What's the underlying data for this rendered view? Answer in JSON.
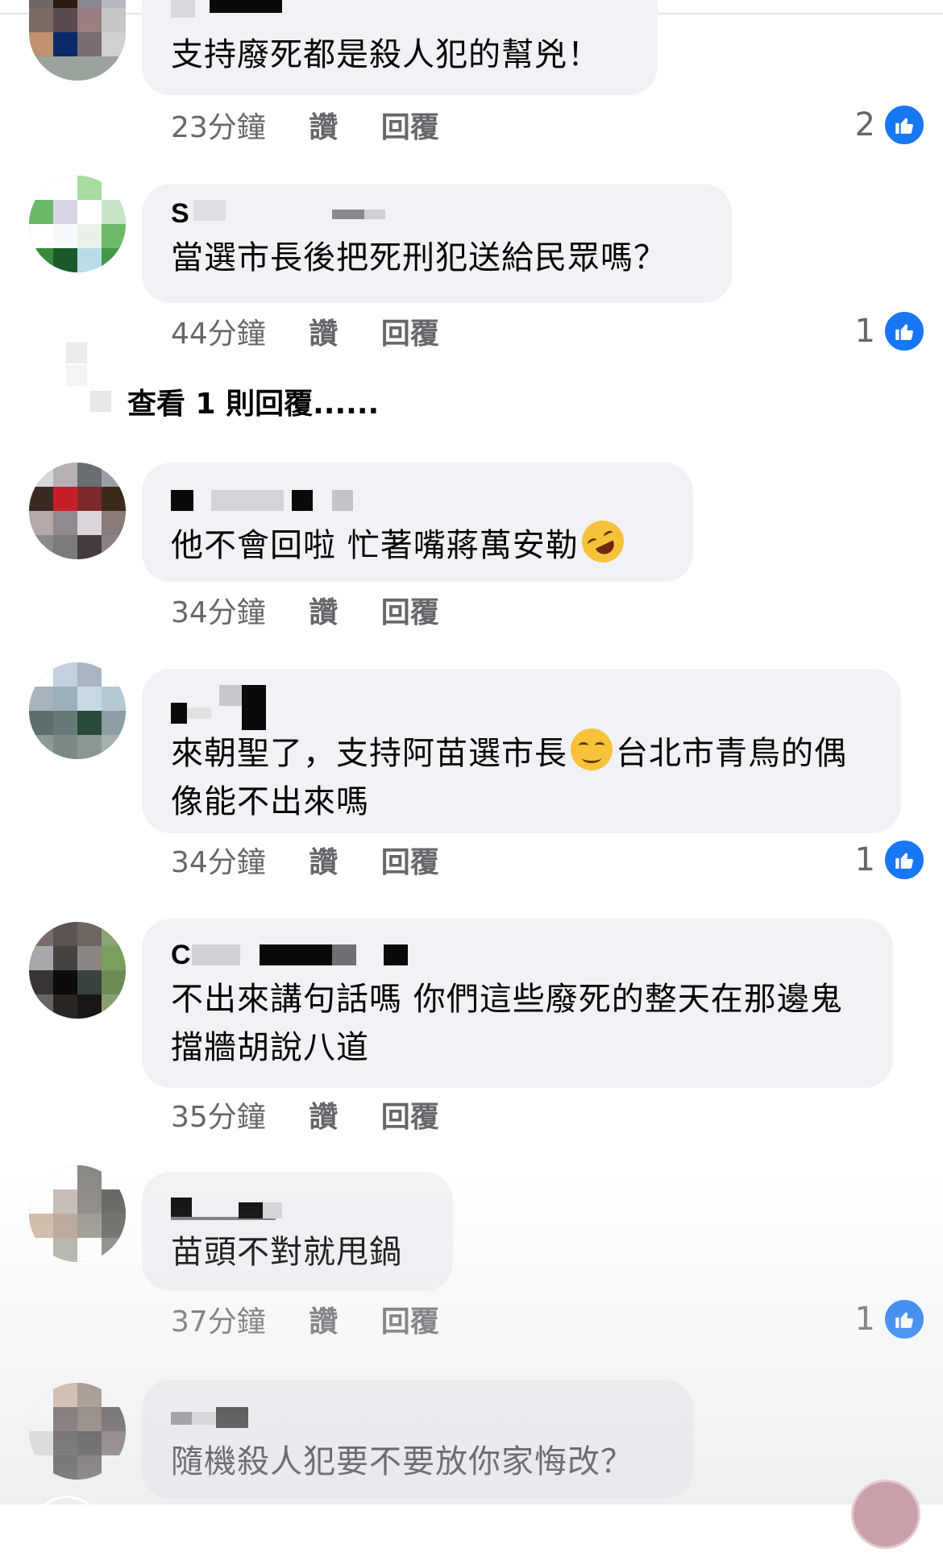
{
  "actions": {
    "like": "讚",
    "reply": "回覆"
  },
  "comments": [
    {
      "author": "",
      "text": "支持廢死都是殺人犯的幫兇！",
      "time": "23分鐘",
      "likes": "2"
    },
    {
      "author": "S",
      "text": "當選市長後把死刑犯送給民眾嗎？",
      "time": "44分鐘",
      "likes": "1"
    },
    {
      "author": "",
      "text": "他不會回啦 忙著嘴蔣萬安勒",
      "time": "34分鐘",
      "likes": ""
    },
    {
      "author": "",
      "text_part1": "來朝聖了，支持阿苗選市長",
      "text_part2": "台北市青鳥的偶像能不出來嗎",
      "time": "34分鐘",
      "likes": "1"
    },
    {
      "author": "C",
      "text": "不出來講句話嗎 你們這些廢死的整天在那邊鬼擋牆胡說八道",
      "time": "35分鐘",
      "likes": ""
    },
    {
      "author": "",
      "text": "苗頭不對就甩鍋",
      "time": "37分鐘",
      "likes": "1"
    },
    {
      "author": "",
      "text": "隨機殺人犯要不要放你家悔改？",
      "time": "",
      "likes": ""
    }
  ],
  "view_replies": "查看 1 則回覆......",
  "icons": {
    "like": "thumbs-up-icon"
  },
  "colors": {
    "like_blue": "#1877f2",
    "bubble": "#f0f2f5",
    "meta_gray": "#65676b"
  }
}
